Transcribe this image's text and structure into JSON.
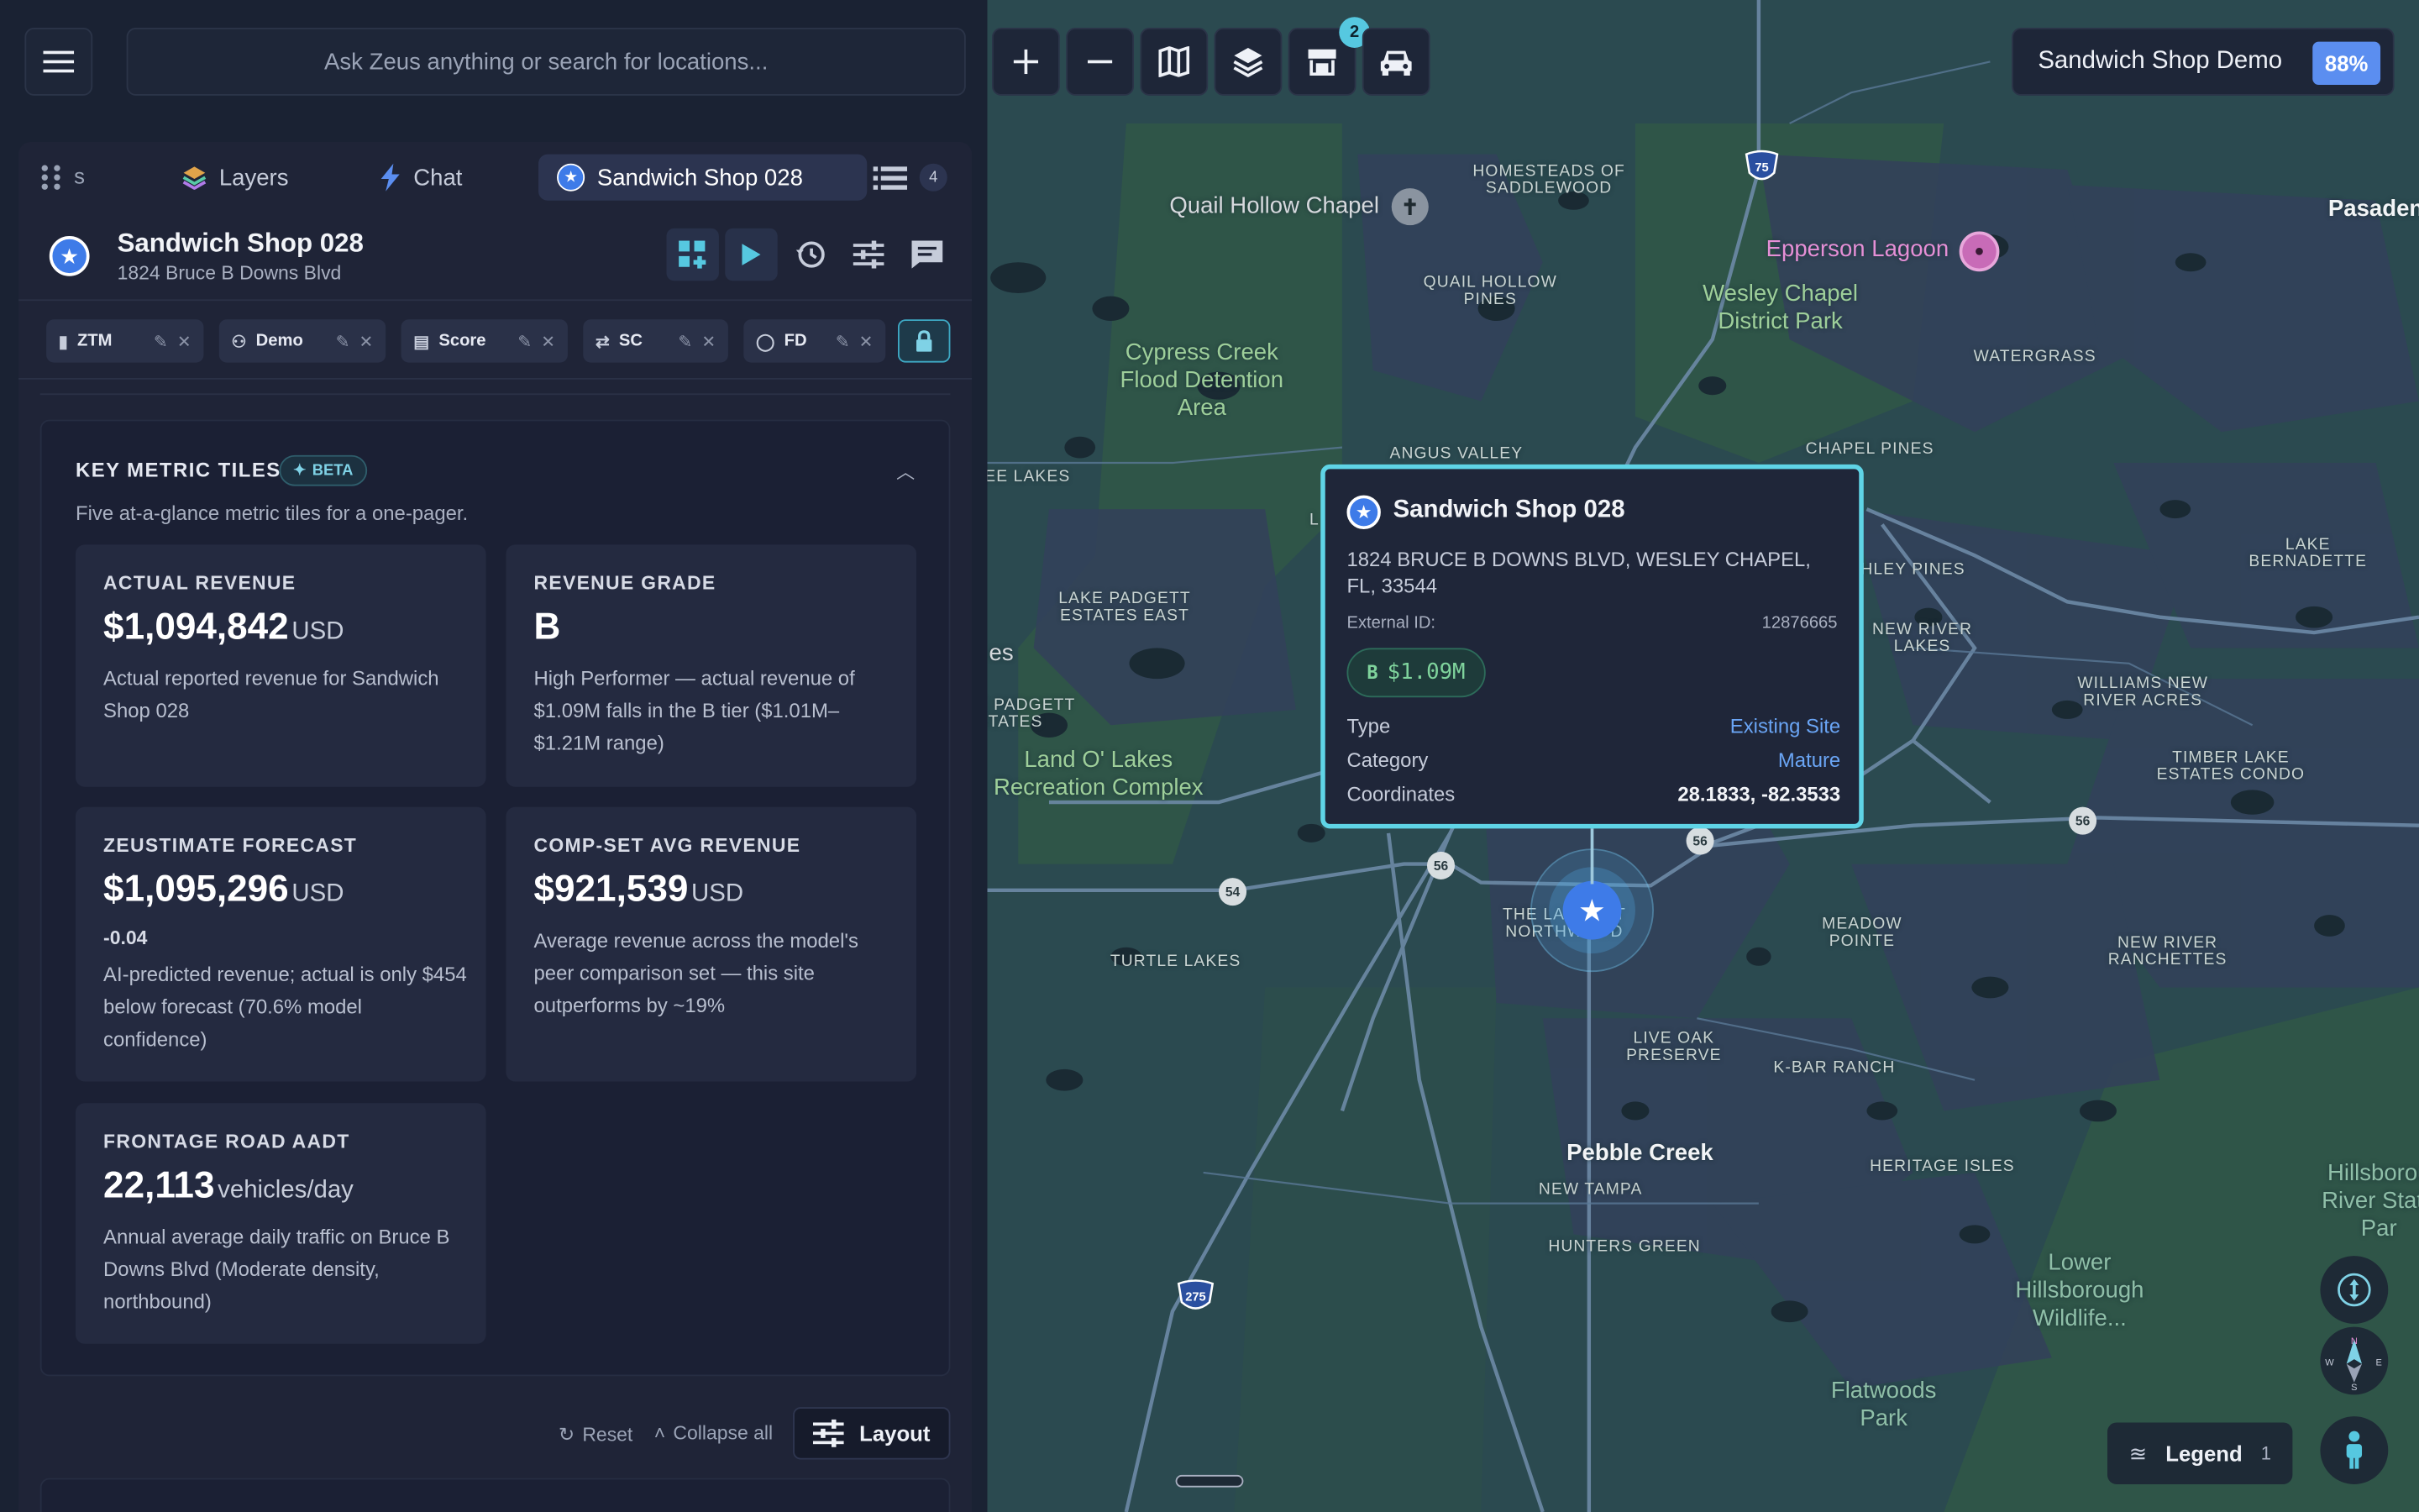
{
  "topbar": {
    "search_placeholder": "Ask Zeus anything or search for locations...",
    "stores_badge": "2",
    "project_name": "Sandwich Shop Demo",
    "project_pct": "88%"
  },
  "panel": {
    "tabs": [
      {
        "label": "Layers"
      },
      {
        "label": "Chat"
      },
      {
        "label": "Sandwich Shop 028"
      }
    ],
    "list_count": "4",
    "site": {
      "title": "Sandwich Shop 028",
      "address": "1824 Bruce B Downs Blvd"
    },
    "chips": [
      {
        "label": "ZTM"
      },
      {
        "label": "Demo"
      },
      {
        "label": "Score"
      },
      {
        "label": "SC"
      },
      {
        "label": "FD"
      }
    ],
    "section": {
      "title": "KEY METRIC TILES",
      "beta": "BETA",
      "subtitle": "Five at-a-glance metric tiles for a one-pager."
    },
    "tiles": [
      {
        "label": "ACTUAL REVENUE",
        "value": "$1,094,842",
        "unit": "USD",
        "desc": "Actual reported revenue for Sandwich Shop 028"
      },
      {
        "label": "REVENUE GRADE",
        "value": "B",
        "unit": "",
        "desc": "High Performer — actual revenue of $1.09M falls in the B tier ($1.01M–$1.21M range)"
      },
      {
        "label": "ZEUSTIMATE FORECAST",
        "value": "$1,095,296",
        "unit": "USD",
        "delta": "-0.04",
        "desc": "AI-predicted revenue; actual is only $454 below forecast (70.6% model confidence)"
      },
      {
        "label": "COMP-SET AVG REVENUE",
        "value": "$921,539",
        "unit": "USD",
        "desc": "Average revenue across the model's peer comparison set — this site outperforms by ~19%"
      },
      {
        "label": "FRONTAGE ROAD AADT",
        "value": "22,113",
        "unit": "vehicles/day",
        "desc": "Annual average daily traffic on Bruce B Downs Blvd (Moderate density, northbound)"
      }
    ],
    "footer": {
      "reset": "Reset",
      "collapse": "Collapse all",
      "layout": "Layout"
    }
  },
  "popup": {
    "title": "Sandwich Shop 028",
    "address": "1824 BRUCE B DOWNS BLVD, WESLEY CHAPEL, FL, 33544",
    "external_id_label": "External ID:",
    "external_id": "12876665",
    "grade_badge": "$1.09M",
    "grade_letter": "B",
    "rows": [
      {
        "label": "Type",
        "value": "Existing Site"
      },
      {
        "label": "Category",
        "value": "Mature"
      },
      {
        "label": "Coordinates",
        "value": "28.1833, -82.3533"
      }
    ]
  },
  "map": {
    "labels": {
      "homesteads": "HOMESTEADS OF SADDLEWOOD",
      "quail_hollow_chapel": "Quail Hollow Chapel",
      "epperson": "Epperson Lagoon",
      "pasadena": "Pasaden",
      "quail_hollow_pines": "QUAIL HOLLOW PINES",
      "wesley_chapel": "Wesley Chapel District Park",
      "cypress_creek": "Cypress Creek Flood Detention Area",
      "watergrass": "WATERGRASS",
      "angus_valley": "ANGUS VALLEY",
      "chapel_pines": "CHAPEL PINES",
      "lakes_left": "EE LAKES",
      "lake_bernadette": "LAKE BERNADETTE",
      "ley_pines": "HLEY PINES",
      "lake_padgett_east": "LAKE PADGETT ESTATES EAST",
      "new_river_lakes": "NEW RIVER LAKES",
      "es": "es",
      "williams_new_river": "WILLIAMS NEW RIVER ACRES",
      "padgett_states": "E PADGETT STATES",
      "land_o_lakes": "Land O' Lakes Recreation Complex",
      "timber_lake": "TIMBER LAKE ESTATES CONDO",
      "the_lakes_northwood": "THE LAKES AT NORTHWOOD",
      "meadow_pointe": "MEADOW POINTE",
      "turtle_lakes": "TURTLE LAKES",
      "new_river_ranchettes": "NEW RIVER RANCHETTES",
      "live_oak": "LIVE OAK PRESERVE",
      "k_bar": "K-BAR RANCH",
      "pebble_creek": "Pebble Creek",
      "new_tampa": "NEW TAMPA",
      "heritage_isles": "HERITAGE ISLES",
      "hillsborough_river": "Hillsborou River State Par",
      "hunters_green": "HUNTERS GREEN",
      "lower_hillsborough": "Lower Hillsborough Wildlife...",
      "flatwoods": "Flatwoods Park",
      "l_fragment": "L"
    },
    "shields": {
      "i75": "75",
      "i275": "275",
      "r54": "54",
      "r56a": "56",
      "r56b": "56",
      "r56c": "56"
    },
    "legend_label": "Legend",
    "legend_count": "1",
    "compass": {
      "n": "N",
      "w": "W",
      "e": "E",
      "s": "S"
    }
  }
}
